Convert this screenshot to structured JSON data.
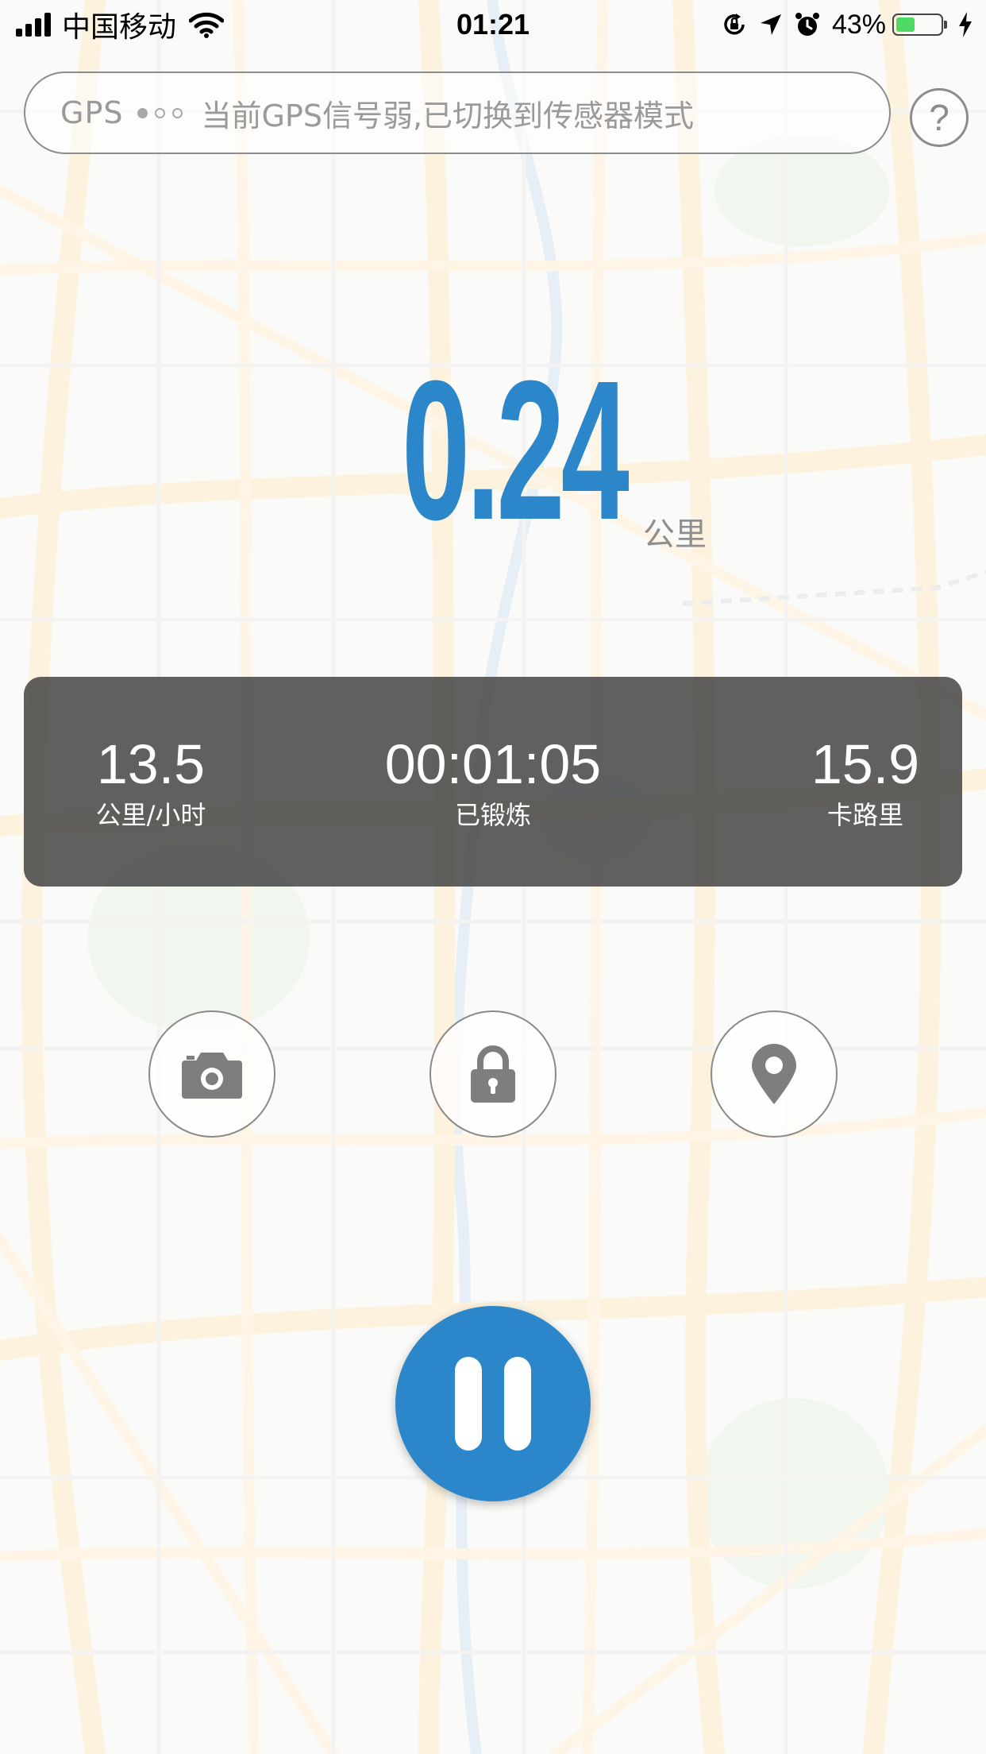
{
  "status_bar": {
    "carrier": "中国移动",
    "time": "01:21",
    "battery_percent": "43%",
    "battery_level": 0.43,
    "signal_bars": 4,
    "icons": [
      "signal-icon",
      "wifi-icon",
      "rotation-lock-icon",
      "location-arrow-icon",
      "alarm-icon",
      "battery-icon",
      "charging-icon"
    ]
  },
  "gps": {
    "label": "GPS",
    "signal_strength": 1,
    "signal_max": 3,
    "message": "当前GPS信号弱,已切换到传感器模式"
  },
  "help": {
    "label": "?"
  },
  "distance": {
    "value": "0.24",
    "unit": "公里"
  },
  "stats": {
    "speed": {
      "value": "13.5",
      "label": "公里/小时"
    },
    "duration": {
      "value": "00:01:05",
      "label": "已锻炼"
    },
    "calories": {
      "value": "15.9",
      "label": "卡路里"
    }
  },
  "actions": {
    "icons": [
      "camera-icon",
      "lock-icon",
      "location-pin-icon"
    ]
  },
  "pause": {
    "icon": "pause-icon"
  },
  "colors": {
    "accent": "#2b87ca",
    "panel": "#464646",
    "muted_text": "#8e8e8e",
    "battery_green": "#4cd964"
  }
}
